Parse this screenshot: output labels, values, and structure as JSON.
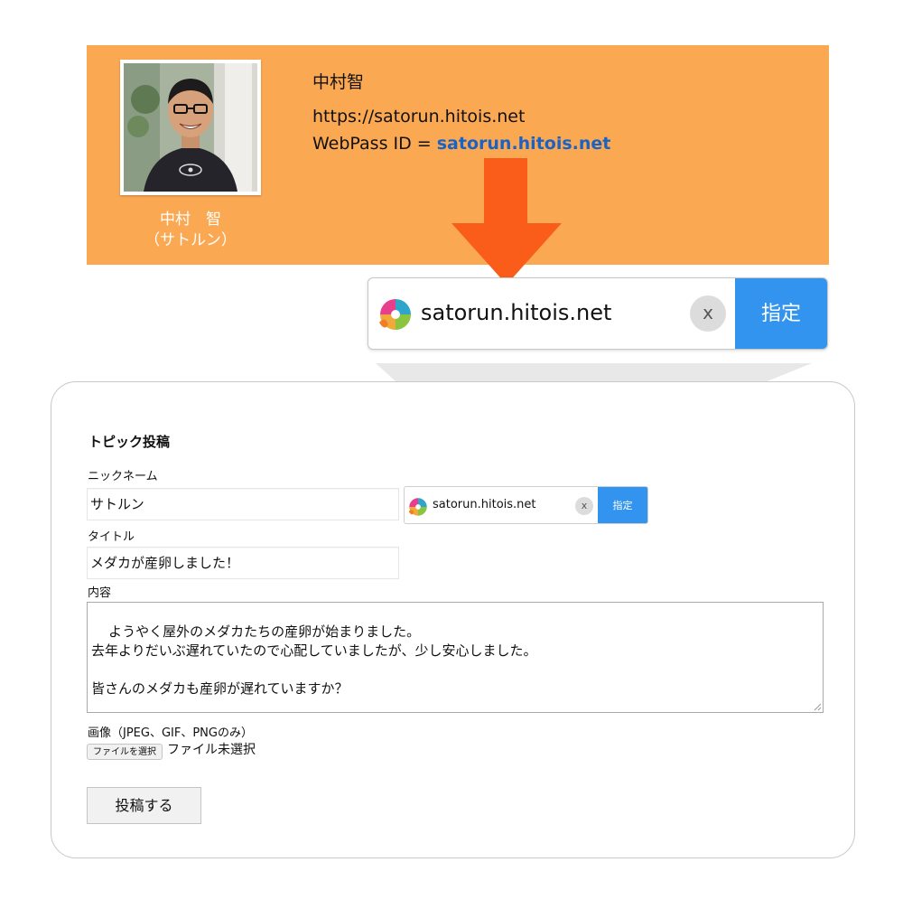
{
  "profile": {
    "name": "中村智",
    "url": "https://satorun.hitois.net",
    "webpass_prefix": "WebPass ID = ",
    "webpass_id": "satorun.hitois.net",
    "caption_line1": "中村　智",
    "caption_line2": "（サトルン）",
    "banner_color": "#fba853",
    "link_color": "#1a63c4"
  },
  "webpass_widget": {
    "id_value": "satorun.hitois.net",
    "clear_label": "x",
    "set_label": "指定",
    "set_color": "#3294ef"
  },
  "arrow_color": "#fa5d1a",
  "form": {
    "heading": "トピック投稿",
    "nickname_label": "ニックネーム",
    "nickname_value": "サトルン",
    "webpass_id_value": "satorun.hitois.net",
    "webpass_clear_label": "x",
    "webpass_set_label": "指定",
    "title_label": "タイトル",
    "title_value": "メダカが産卵しました！",
    "content_label": "内容",
    "content_value": "ようやく屋外のメダカたちの産卵が始まりました。\n去年よりだいぶ遅れていたので心配していましたが、少し安心しました。\n\n皆さんのメダカも産卵が遅れていますか？",
    "image_label": "画像（JPEG、GIF、PNGのみ）",
    "file_button_label": "ファイルを選択",
    "file_status": "ファイル未選択",
    "submit_label": "投稿する"
  }
}
